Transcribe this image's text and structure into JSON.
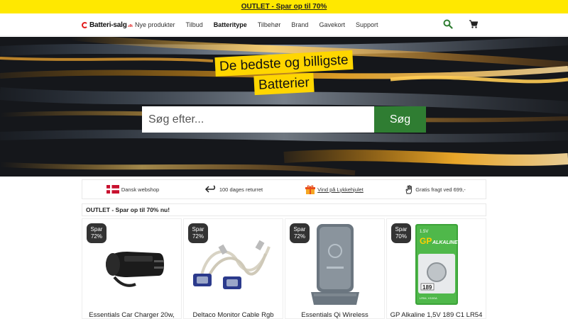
{
  "announcement": {
    "text": "OUTLET - Spar op til 70%"
  },
  "header": {
    "logo_text": "Batteri-salg",
    "logo_tld": ".dk",
    "menu": [
      "Nye produkter",
      "Tilbud",
      "Batteritype",
      "Tilbehør",
      "Brand",
      "Gavekort",
      "Support"
    ],
    "active_menu": "Batteritype"
  },
  "hero": {
    "headline_line1": "De bedste og billigste",
    "headline_line2": "Batterier",
    "search_placeholder": "Søg efter...",
    "search_button": "Søg"
  },
  "usps": [
    {
      "icon": "danish-flag-icon",
      "text": "Dansk webshop"
    },
    {
      "icon": "return-arrow-icon",
      "text": "100 dages returret"
    },
    {
      "icon": "gift-icon",
      "text": "Vind på Lykkehjulet"
    },
    {
      "icon": "hand-icon",
      "text": "Gratis fragt ved 699,-"
    }
  ],
  "section_title": "OUTLET - Spar op til 70% nu!",
  "products": [
    {
      "badge_line1": "Spar",
      "badge_line2": "72%",
      "name": "Essentials Car Charger 20w,",
      "image": "car-charger"
    },
    {
      "badge_line1": "Spar",
      "badge_line2": "72%",
      "name": "Deltaco Monitor Cable Rgb",
      "image": "vga-cable"
    },
    {
      "badge_line1": "Spar",
      "badge_line2": "72%",
      "name": "Essentials Qi Wireless",
      "image": "wireless-charger"
    },
    {
      "badge_line1": "Spar",
      "badge_line2": "70%",
      "name": "GP Alkaline 1,5V 189 C1 LR54",
      "image": "gp-battery",
      "package_text": {
        "voltage": "1.5V",
        "brand": "GP",
        "line": "ALKALINE",
        "model": "189",
        "codes": "LR54, V10GA"
      }
    }
  ],
  "colors": {
    "accent_yellow": "#ffe800",
    "search_green": "#2f7d32",
    "badge_dark": "#333333"
  }
}
